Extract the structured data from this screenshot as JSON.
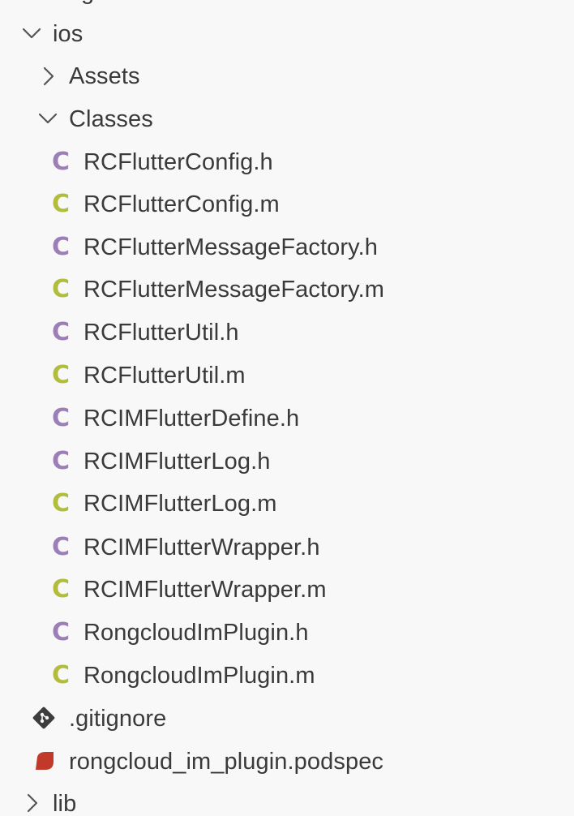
{
  "explorer": {
    "ios": {
      "label": "ios"
    },
    "assets": {
      "label": "Assets"
    },
    "classes": {
      "label": "Classes"
    },
    "files": [
      {
        "name": "RCFlutterConfig.h",
        "icon": "C",
        "ext": "h"
      },
      {
        "name": "RCFlutterConfig.m",
        "icon": "C",
        "ext": "m"
      },
      {
        "name": "RCFlutterMessageFactory.h",
        "icon": "C",
        "ext": "h"
      },
      {
        "name": "RCFlutterMessageFactory.m",
        "icon": "C",
        "ext": "m"
      },
      {
        "name": "RCFlutterUtil.h",
        "icon": "C",
        "ext": "h"
      },
      {
        "name": "RCFlutterUtil.m",
        "icon": "C",
        "ext": "m"
      },
      {
        "name": "RCIMFlutterDefine.h",
        "icon": "C",
        "ext": "h"
      },
      {
        "name": "RCIMFlutterLog.h",
        "icon": "C",
        "ext": "h"
      },
      {
        "name": "RCIMFlutterLog.m",
        "icon": "C",
        "ext": "m"
      },
      {
        "name": "RCIMFlutterWrapper.h",
        "icon": "C",
        "ext": "h"
      },
      {
        "name": "RCIMFlutterWrapper.m",
        "icon": "C",
        "ext": "m"
      },
      {
        "name": "RongcloudImPlugin.h",
        "icon": "C",
        "ext": "h"
      },
      {
        "name": "RongcloudImPlugin.m",
        "icon": "C",
        "ext": "m"
      }
    ],
    "gitignore": {
      "label": ".gitignore",
      "icon": "git-icon"
    },
    "podspec": {
      "label": "rongcloud_im_plugin.podspec",
      "icon": "ruby-icon"
    },
    "lib": {
      "label": "lib"
    }
  },
  "colors": {
    "header_icon": "#9b7fb6",
    "source_icon": "#b2bd3e",
    "git_icon": "#3d3d3d",
    "ruby_icon": "#c0392b",
    "text": "#3a3a3a",
    "background": "#f8f8f8"
  }
}
